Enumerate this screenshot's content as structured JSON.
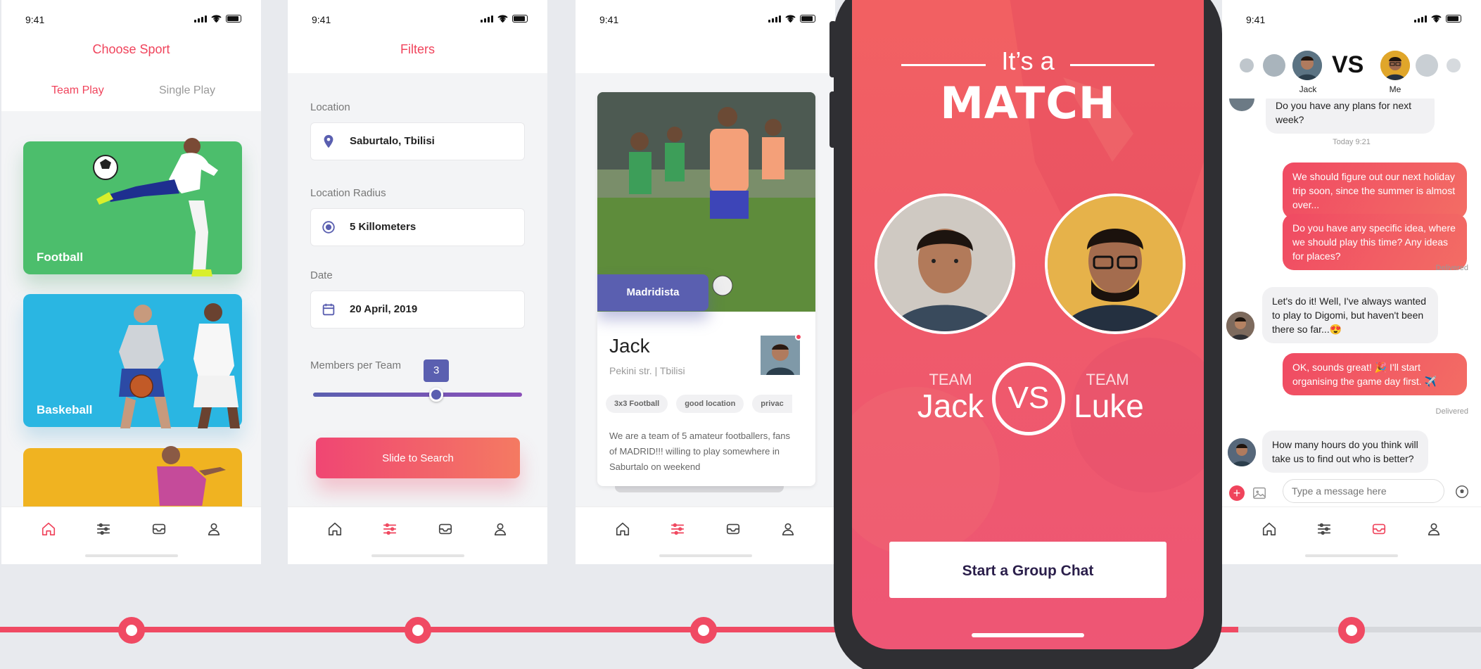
{
  "status_time": "9:41",
  "sport": {
    "title": "Choose Sport",
    "tab_team": "Team Play",
    "tab_single": "Single Play",
    "cards": [
      "Football",
      "Baskeball"
    ]
  },
  "filters": {
    "title": "Filters",
    "location_label": "Location",
    "location_value": "Saburtalo, Tbilisi",
    "radius_label": "Location Radius",
    "radius_value": "5 Killometers",
    "date_label": "Date",
    "date_value": "20 April, 2019",
    "members_label": "Members per Team",
    "members_value": "3",
    "slider_fraction": 0.59,
    "button": "Slide to Search"
  },
  "team_card": {
    "badge": "Madridista",
    "name": "Jack",
    "address": "Pekini str. | Tbilisi",
    "tags": [
      "3x3 Football",
      "good location",
      "privac"
    ],
    "description": "We are a team of 5 amateur footballers, fans of MADRID!!! willing to play somewhere in Saburtalo on weekend"
  },
  "match": {
    "its_a": "It’s a",
    "headline": "MATCH",
    "team_word": "TEAM",
    "team_left": "Jack",
    "team_right": "Luke",
    "vs": "VS",
    "button": "Start a Group Chat"
  },
  "chat": {
    "header_left_name": "Jack",
    "header_right_name": "Me",
    "header_vs": "VS",
    "m0": "Do you have any plans for next week?",
    "ts": "Today 9:21",
    "m1": "We should figure out our next holiday trip soon, since the summer is almost over...",
    "m2": "Do you have any specific idea, where we should play this time? Any ideas for places?",
    "d1": "Delivered",
    "m3": "Let's do it! Well, I've always wanted to play to Digomi, but haven't been there so far...😍",
    "m4": "OK, sounds great! 🎉 I'll start organising the game day first. ✈️",
    "d2": "Delivered",
    "m5": "How many hours do you think will take us to find out who is better?",
    "input_placeholder": "Type a message here"
  },
  "colors": {
    "accent": "#f0445c",
    "indigo": "#5a5fb0",
    "football_card": "#4cbe6c",
    "basketball_card": "#2ab6e2",
    "third_card": "#f0b321"
  }
}
